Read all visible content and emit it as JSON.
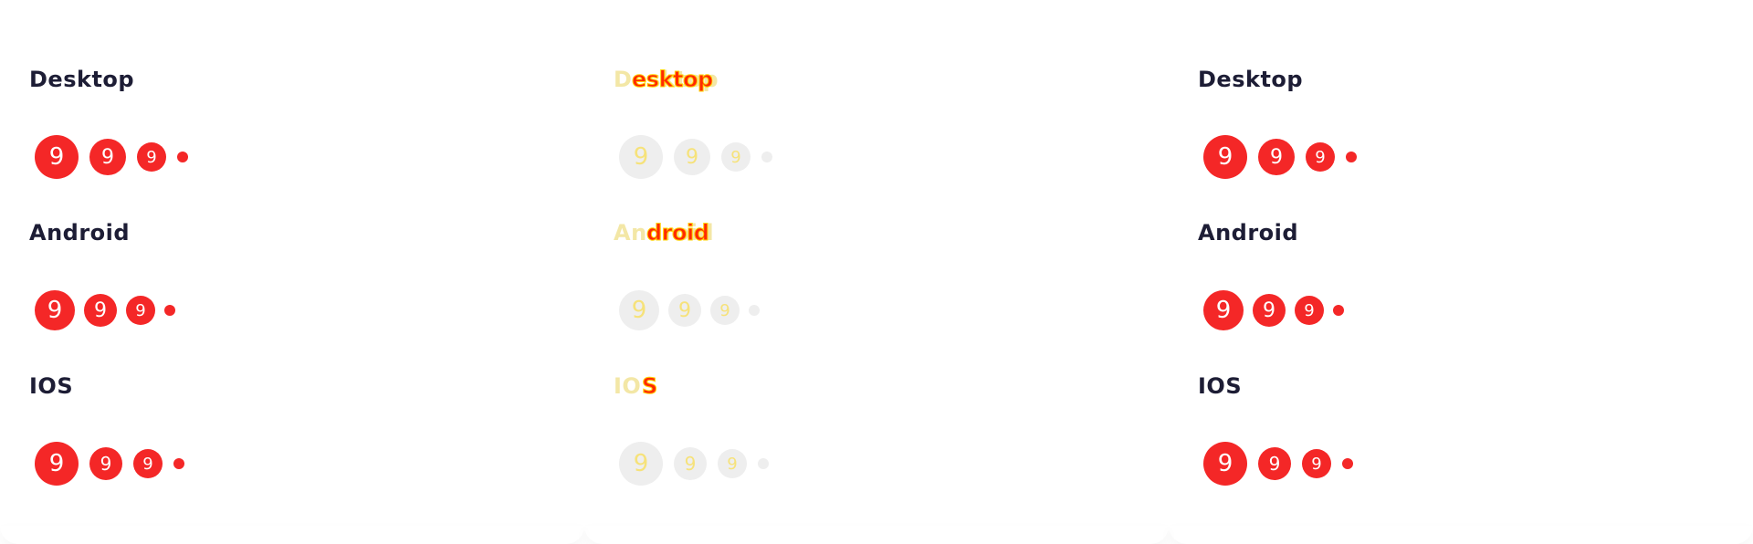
{
  "columns": [
    {
      "state": "default",
      "sections": [
        {
          "title": "Desktop",
          "badges": [
            "9",
            "9",
            "9"
          ]
        },
        {
          "title": "Android",
          "badges": [
            "9",
            "9",
            "9"
          ]
        },
        {
          "title": "IOS",
          "badges": [
            "9",
            "9",
            "9"
          ]
        }
      ]
    },
    {
      "state": "ghost",
      "sections": [
        {
          "title": "Desktop",
          "overlay": "esktop",
          "badges": [
            "9",
            "9",
            "9"
          ]
        },
        {
          "title": "Android",
          "overlay": "droid",
          "badges": [
            "9",
            "9",
            "9"
          ]
        },
        {
          "title": "IOS",
          "overlay": "S",
          "badges": [
            "9",
            "9",
            "9"
          ]
        }
      ]
    },
    {
      "state": "default",
      "sections": [
        {
          "title": "Desktop",
          "badges": [
            "9",
            "9",
            "9"
          ]
        },
        {
          "title": "Android",
          "badges": [
            "9",
            "9",
            "9"
          ]
        },
        {
          "title": "IOS",
          "badges": [
            "9",
            "9",
            "9"
          ]
        }
      ]
    }
  ],
  "colors": {
    "badge_red": "#f42727",
    "title_text": "#1d1d35",
    "ghost_bg": "#eeeeee"
  }
}
